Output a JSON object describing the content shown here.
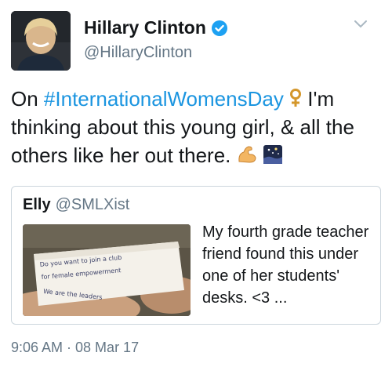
{
  "author": {
    "name": "Hillary Clinton",
    "handle": "@HillaryClinton",
    "verified": true
  },
  "tweet": {
    "text_before": "On ",
    "hashtag": "#InternationalWomensDay",
    "text_after": " I'm thinking about this young girl, & all the others like her out there.",
    "emojis": [
      "female-sign-icon",
      "flexed-biceps-icon",
      "night-sky-icon"
    ]
  },
  "quote": {
    "name": "Elly",
    "handle": "@SMLXist",
    "text": "My fourth grade teacher friend found this under one of her students' desks. <3 ...",
    "image_note_lines": [
      "Do you want to join a club",
      "for female empowerment",
      "We are the leaders"
    ]
  },
  "timestamp": "9:06 AM · 08 Mar 17",
  "colors": {
    "link": "#1b95e0",
    "secondary": "#657786",
    "verified": "#1da1f2"
  }
}
